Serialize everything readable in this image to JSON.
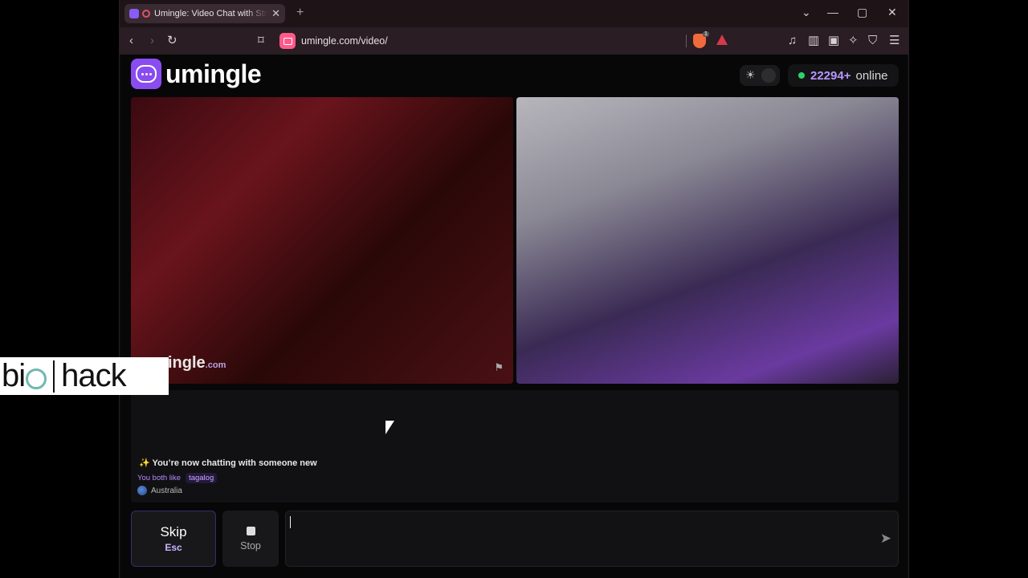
{
  "browser": {
    "tab_title": "Umingle: Video Chat with Strangers",
    "url": "umingle.com/video/",
    "brave_shield_count": "1"
  },
  "header": {
    "logo_text": "umingle",
    "online_count": "22294+",
    "online_label": "online"
  },
  "video": {
    "watermark_main": "umingle",
    "watermark_suffix": ".com"
  },
  "chat": {
    "system_message": "✨ You’re now chatting with someone new",
    "like_label": "You both like",
    "like_tag": "tagalog",
    "country": "Australia"
  },
  "controls": {
    "skip_label": "Skip",
    "skip_shortcut": "Esc",
    "stop_label": "Stop",
    "message_value": ""
  },
  "overlay": {
    "brand_left": "bi",
    "brand_right": "hack"
  },
  "colors": {
    "accent": "#8a4cf0",
    "online_dot": "#2bd46a",
    "tab_bg": "#3a2a31",
    "toolbar_bg": "#2a1d24"
  },
  "icons": [
    "back-icon",
    "forward-icon",
    "reload-icon",
    "bookmark-icon",
    "camera-icon",
    "brave-shield-icon",
    "bat-icon",
    "music-icon",
    "sidebar-icon",
    "wallet-icon",
    "leo-icon",
    "vpn-icon",
    "menu-icon",
    "sun-icon",
    "flag-icon",
    "send-icon",
    "stop-icon"
  ]
}
